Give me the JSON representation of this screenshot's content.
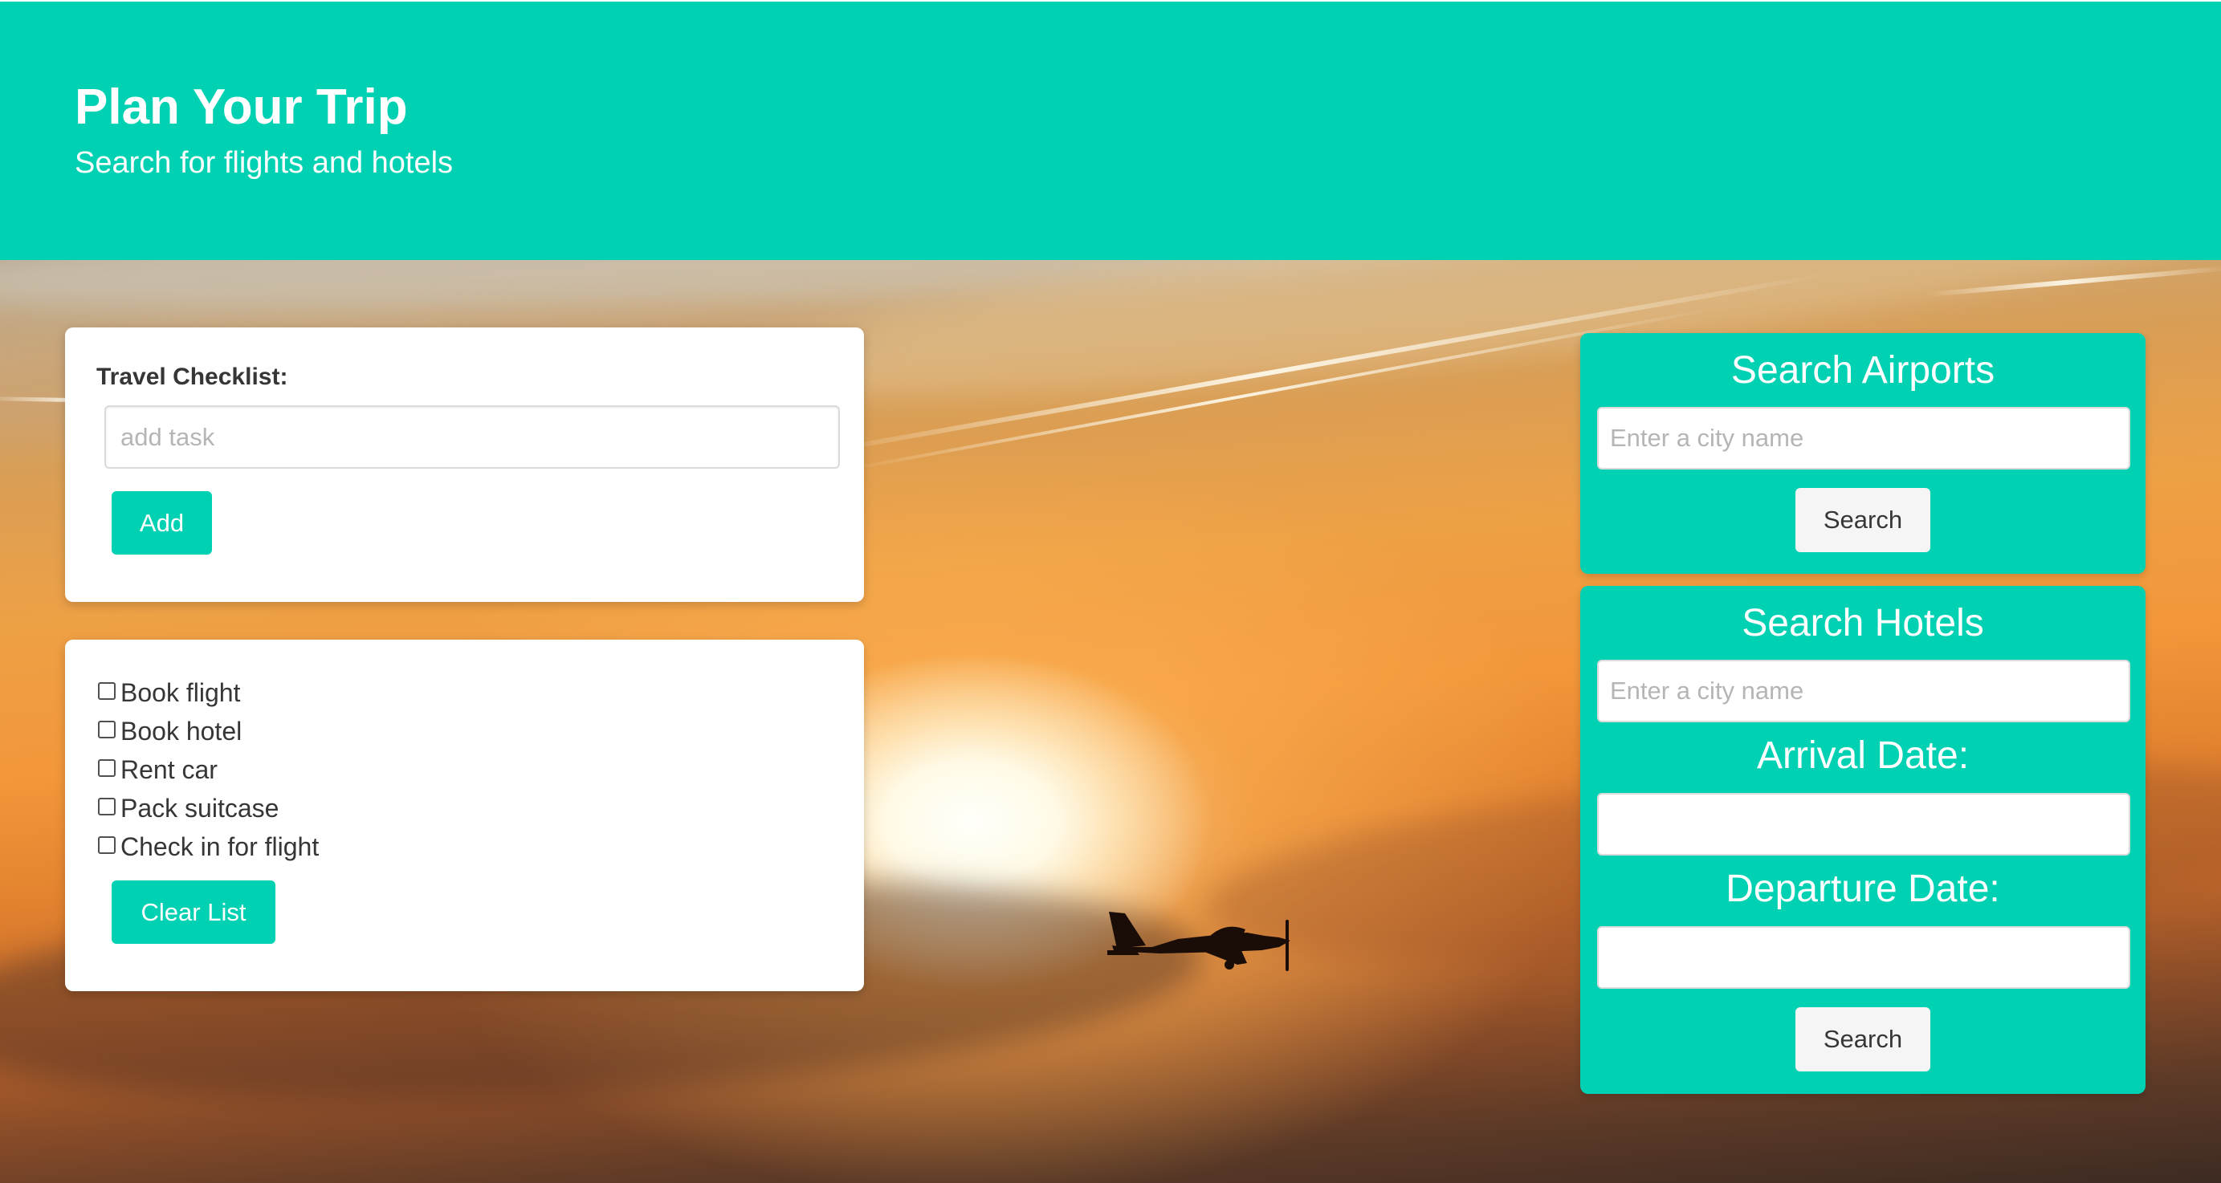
{
  "hero": {
    "title": "Plan Your Trip",
    "subtitle": "Search for flights and hotels"
  },
  "checklist": {
    "label": "Travel Checklist:",
    "input_placeholder": "add task",
    "add_button": "Add",
    "clear_button": "Clear List",
    "tasks": [
      {
        "label": "Book flight",
        "checked": false
      },
      {
        "label": "Book hotel",
        "checked": false
      },
      {
        "label": "Rent car",
        "checked": false
      },
      {
        "label": "Pack suitcase",
        "checked": false
      },
      {
        "label": "Check in for flight",
        "checked": false
      }
    ]
  },
  "airports": {
    "title": "Search Airports",
    "city_placeholder": "Enter a city name",
    "search_button": "Search"
  },
  "hotels": {
    "title": "Search Hotels",
    "city_placeholder": "Enter a city name",
    "arrival_label": "Arrival Date:",
    "arrival_value": "",
    "departure_label": "Departure Date:",
    "departure_value": "",
    "search_button": "Search"
  },
  "colors": {
    "accent": "#00d1b2",
    "button_light": "#f5f5f5",
    "text_dark": "#363636"
  },
  "icons": {
    "background": "sunset-sky-airplane-photo",
    "checkbox": "checkbox-unchecked-icon"
  }
}
